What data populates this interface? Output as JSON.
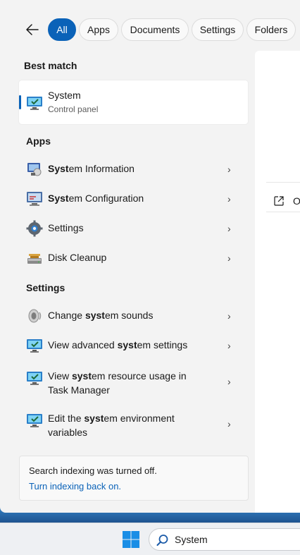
{
  "filters": {
    "tabs": [
      {
        "label": "All",
        "active": true
      },
      {
        "label": "Apps"
      },
      {
        "label": "Documents"
      },
      {
        "label": "Settings"
      },
      {
        "label": "Folders"
      }
    ]
  },
  "best_match": {
    "heading": "Best match",
    "title": "System",
    "subtitle": "Control panel"
  },
  "apps": {
    "heading": "Apps",
    "items": [
      {
        "pre": "",
        "bold": "Syst",
        "post": "em Information",
        "icon": "system-info-icon"
      },
      {
        "pre": "",
        "bold": "Syst",
        "post": "em Configuration",
        "icon": "system-config-icon"
      },
      {
        "pre": "Settings",
        "bold": "",
        "post": "",
        "icon": "gear-icon"
      },
      {
        "pre": "Disk Cleanup",
        "bold": "",
        "post": "",
        "icon": "disk-cleanup-icon"
      }
    ]
  },
  "settings": {
    "heading": "Settings",
    "items": [
      {
        "pre": "Change ",
        "bold": "syst",
        "post": "em sounds",
        "icon": "speaker-icon"
      },
      {
        "pre": "View advanced ",
        "bold": "syst",
        "post": "em settings",
        "icon": "monitor-check-icon"
      },
      {
        "pre": "View ",
        "bold": "syst",
        "post": "em resource usage in Task Manager",
        "icon": "monitor-check-icon"
      },
      {
        "pre": "Edit the ",
        "bold": "syst",
        "post": "em environment variables",
        "icon": "monitor-check-icon"
      }
    ]
  },
  "indexing": {
    "message": "Search indexing was turned off.",
    "link": "Turn indexing back on."
  },
  "preview": {
    "open_label": "O"
  },
  "taskbar": {
    "search_value": "System"
  },
  "colors": {
    "accent": "#0a62b8"
  }
}
